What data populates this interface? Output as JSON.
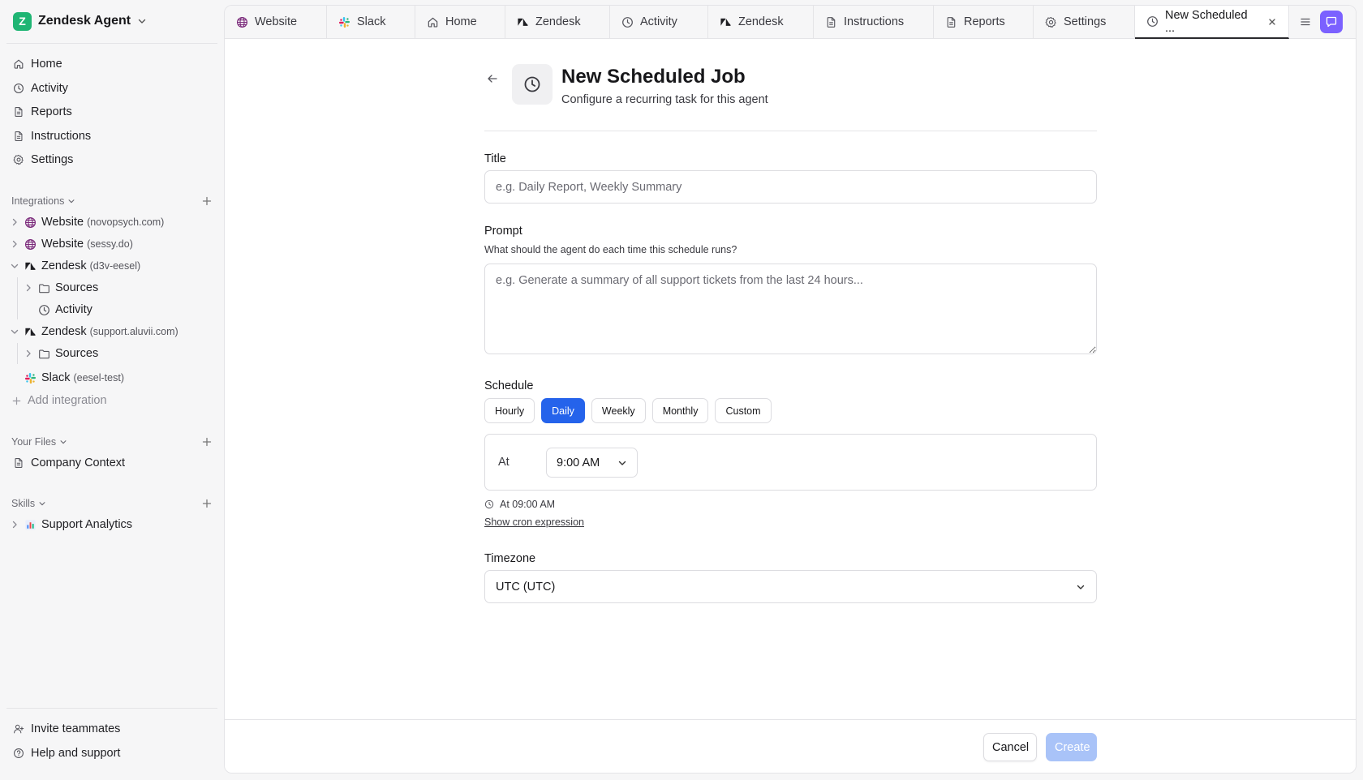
{
  "workspace": {
    "name": "Zendesk Agent",
    "logo_letter": "Z",
    "logo_color": "#1fb574"
  },
  "nav": [
    {
      "label": "Home",
      "icon": "home-icon"
    },
    {
      "label": "Activity",
      "icon": "clock-icon"
    },
    {
      "label": "Reports",
      "icon": "document-icon"
    },
    {
      "label": "Instructions",
      "icon": "document-icon"
    },
    {
      "label": "Settings",
      "icon": "gear-icon"
    }
  ],
  "integrations": {
    "heading": "Integrations",
    "items": [
      {
        "name": "Website",
        "detail": "(novopsych.com)",
        "icon": "globe-icon",
        "expanded": false
      },
      {
        "name": "Website",
        "detail": "(sessy.do)",
        "icon": "globe-icon",
        "expanded": false
      },
      {
        "name": "Zendesk",
        "detail": "(d3v-eesel)",
        "icon": "zendesk-icon",
        "expanded": true,
        "children": [
          {
            "label": "Sources",
            "icon": "folder-icon"
          },
          {
            "label": "Activity",
            "icon": "clock-icon"
          }
        ]
      },
      {
        "name": "Zendesk",
        "detail": "(support.aluvii.com)",
        "icon": "zendesk-icon",
        "expanded": true,
        "children": [
          {
            "label": "Sources",
            "icon": "folder-icon"
          }
        ]
      },
      {
        "name": "Slack",
        "detail": "(eesel-test)",
        "icon": "slack-icon"
      }
    ],
    "add_label": "Add integration"
  },
  "files": {
    "heading": "Your Files",
    "items": [
      {
        "label": "Company Context",
        "icon": "document-icon"
      }
    ]
  },
  "skills": {
    "heading": "Skills",
    "items": [
      {
        "label": "Support Analytics",
        "icon": "bar-chart-icon"
      }
    ]
  },
  "bottom_nav": [
    {
      "label": "Invite teammates",
      "icon": "user-plus-icon"
    },
    {
      "label": "Help and support",
      "icon": "help-circle-icon"
    }
  ],
  "tabs": [
    {
      "label": "Website",
      "icon": "globe-icon"
    },
    {
      "label": "Slack",
      "icon": "slack-icon"
    },
    {
      "label": "Home",
      "icon": "home-icon"
    },
    {
      "label": "Zendesk",
      "icon": "zendesk-icon"
    },
    {
      "label": "Activity",
      "icon": "clock-icon"
    },
    {
      "label": "Zendesk",
      "icon": "zendesk-icon"
    },
    {
      "label": "Instructions",
      "icon": "document-icon"
    },
    {
      "label": "Reports",
      "icon": "document-icon"
    },
    {
      "label": "Settings",
      "icon": "gear-icon"
    },
    {
      "label": "New Scheduled ...",
      "icon": "clock-icon",
      "active": true
    }
  ],
  "form": {
    "title": "New Scheduled Job",
    "subtitle": "Configure a recurring task for this agent",
    "title_field": {
      "label": "Title",
      "placeholder": "e.g. Daily Report, Weekly Summary",
      "value": ""
    },
    "prompt_field": {
      "label": "Prompt",
      "help": "What should the agent do each time this schedule runs?",
      "placeholder": "e.g. Generate a summary of all support tickets from the last 24 hours...",
      "value": ""
    },
    "schedule": {
      "label": "Schedule",
      "options": [
        "Hourly",
        "Daily",
        "Weekly",
        "Monthly",
        "Custom"
      ],
      "selected": "Daily",
      "at_label": "At",
      "time": "9:00 AM",
      "summary": "At 09:00 AM",
      "cron_link": "Show cron expression"
    },
    "timezone": {
      "label": "Timezone",
      "value": "UTC (UTC)"
    }
  },
  "footer": {
    "cancel": "Cancel",
    "create": "Create"
  },
  "colors": {
    "accent": "#2563eb",
    "create_disabled": "#a9c3f8",
    "chat_button": "#7b61ff"
  }
}
